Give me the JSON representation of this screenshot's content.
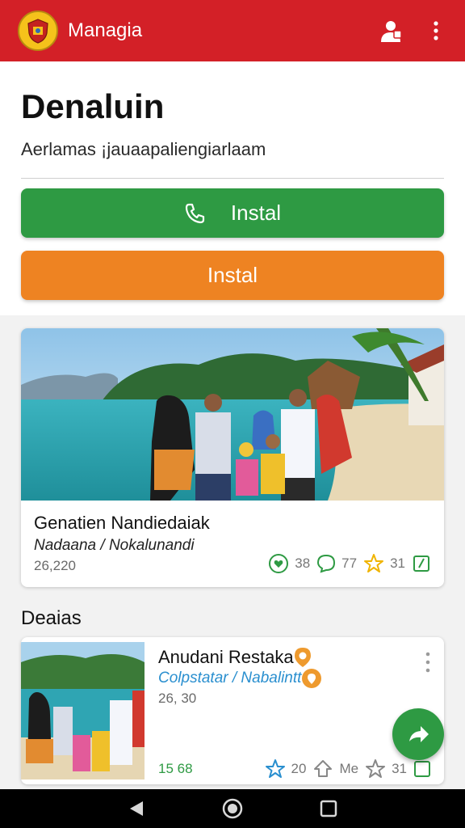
{
  "appbar": {
    "title": "Managia",
    "color": "#d32027"
  },
  "hero": {
    "title": "Denaluin",
    "subtitle": "Aerlamas ¡jauaapaliengiarlaam",
    "primary_button": "Instal",
    "secondary_button": "Instal"
  },
  "featured": {
    "title": "Genatien Nandiedaiak",
    "subtitle": "Nadaana / Nokalunandi",
    "number": "26,220",
    "stats": {
      "hearts": "38",
      "comments": "77",
      "stars": "31"
    }
  },
  "section": {
    "label": "Deaias"
  },
  "item": {
    "title": "Anudani Restaka",
    "subtitle": "Colpstatar / Nabalintt",
    "number": "26, 30",
    "count": "15 68",
    "stats": {
      "stars": "20",
      "shares": "Me",
      "favorites": "31"
    }
  },
  "colors": {
    "green": "#2e9a43",
    "orange": "#ee8322",
    "red": "#d32027",
    "link": "#2a8fcf"
  }
}
